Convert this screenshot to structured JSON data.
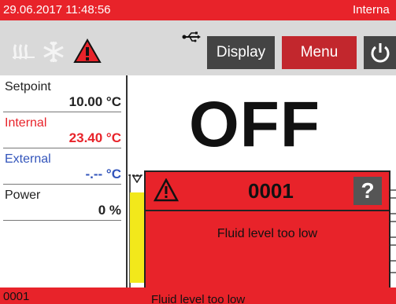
{
  "status_bar": {
    "datetime": "29.06.2017 11:48:56",
    "sensor_label": "Interna"
  },
  "toolbar": {
    "display_label": "Display",
    "menu_label": "Menu",
    "icons": [
      "heating-icon",
      "cooling-icon",
      "warning-icon",
      "usb-icon",
      "power-icon"
    ]
  },
  "readings": {
    "setpoint": {
      "label": "Setpoint",
      "value": "10.00 °C"
    },
    "internal": {
      "label": "Internal",
      "value": "23.40 °C"
    },
    "external": {
      "label": "External",
      "value": "-.-- °C"
    },
    "power": {
      "label": "Power",
      "value": "0 %"
    }
  },
  "main_status": "OFF",
  "alarm": {
    "code": "0001",
    "message": "Fluid level too low",
    "help_label": "?"
  },
  "bottom_bar": {
    "code": "0001",
    "message": "Fluid level too low"
  },
  "colors": {
    "alarm_red": "#e8232a",
    "menu_red": "#c2272d",
    "button_dark": "#444444",
    "external_blue": "#3355bb",
    "level_yellow": "#f2e81b"
  }
}
